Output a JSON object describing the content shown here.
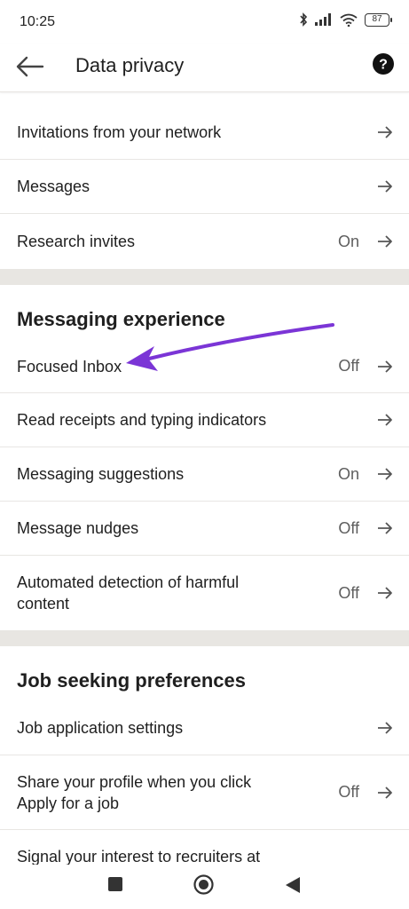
{
  "status_bar": {
    "time": "10:25",
    "battery": "87"
  },
  "header": {
    "title": "Data privacy"
  },
  "group1": {
    "items": [
      {
        "label": "Invitations from your network",
        "value": ""
      },
      {
        "label": "Messages",
        "value": ""
      },
      {
        "label": "Research invites",
        "value": "On"
      }
    ]
  },
  "messaging": {
    "title": "Messaging experience",
    "items": [
      {
        "label": "Focused Inbox",
        "value": "Off"
      },
      {
        "label": "Read receipts and typing indicators",
        "value": ""
      },
      {
        "label": "Messaging suggestions",
        "value": "On"
      },
      {
        "label": "Message nudges",
        "value": "Off"
      },
      {
        "label": "Automated detection of harmful content",
        "value": "Off"
      }
    ]
  },
  "job": {
    "title": "Job seeking preferences",
    "items": [
      {
        "label": "Job application settings",
        "value": ""
      },
      {
        "label": "Share your profile when you click Apply for a job",
        "value": "Off"
      },
      {
        "label": "Signal your interest to recruiters at",
        "value": ""
      }
    ]
  },
  "colors": {
    "annotation_arrow": "#7b35d6",
    "divider": "#e8e6e2"
  },
  "icons": [
    "back-arrow-icon",
    "help-icon",
    "chevron-right-arrow-icon",
    "bluetooth-icon",
    "signal-icon",
    "wifi-icon",
    "battery-icon"
  ]
}
